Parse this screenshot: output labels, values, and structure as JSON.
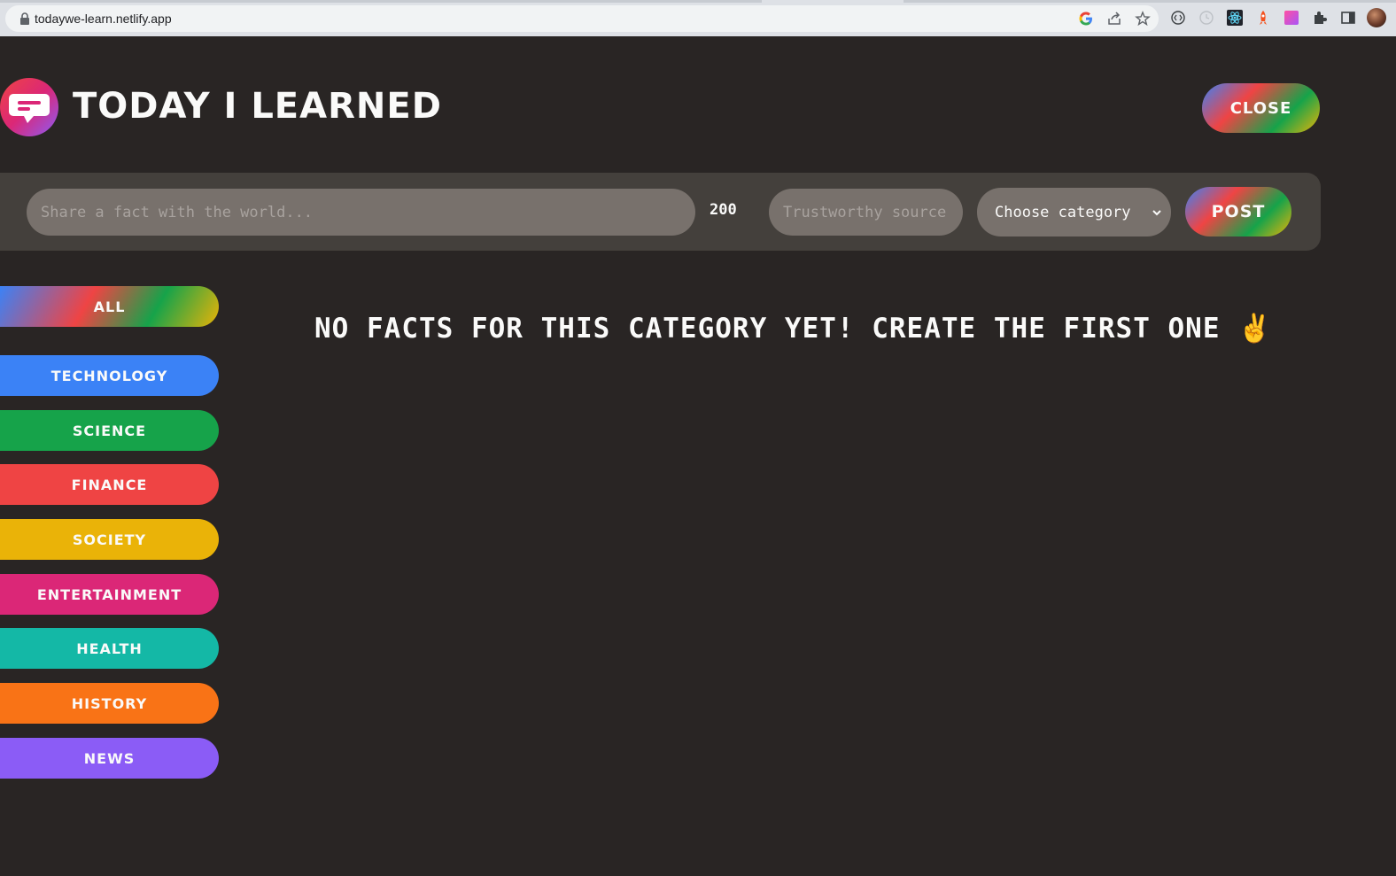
{
  "browser": {
    "url": "todaywe-learn.netlify.app"
  },
  "header": {
    "title": "TODAY I LEARNED",
    "close_label": "CLOSE"
  },
  "form": {
    "fact_placeholder": "Share a fact with the world...",
    "char_count": "200",
    "source_placeholder": "Trustworthy source...",
    "category_label": "Choose category",
    "post_label": "POST"
  },
  "categories": [
    {
      "label": "ALL",
      "color": "gradient"
    },
    {
      "label": "TECHNOLOGY",
      "color": "#3b82f6"
    },
    {
      "label": "SCIENCE",
      "color": "#16a34a"
    },
    {
      "label": "FINANCE",
      "color": "#ef4444"
    },
    {
      "label": "SOCIETY",
      "color": "#eab308"
    },
    {
      "label": "ENTERTAINMENT",
      "color": "#db2777"
    },
    {
      "label": "HEALTH",
      "color": "#14b8a6"
    },
    {
      "label": "HISTORY",
      "color": "#f97316"
    },
    {
      "label": "NEWS",
      "color": "#8b5cf6"
    }
  ],
  "message": "NO FACTS FOR THIS CATEGORY YET! CREATE THE FIRST ONE ✌️"
}
